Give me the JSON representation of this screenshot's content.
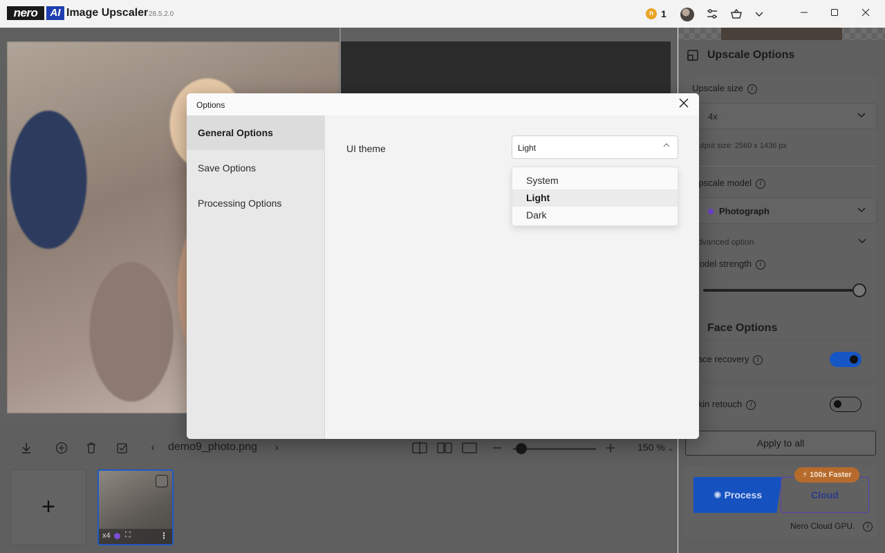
{
  "app": {
    "logo_nero": "nero",
    "logo_ai": "AI",
    "title": "Image Upscaler",
    "version": "28.5.2.0",
    "credits": "1",
    "coin_letter": "n"
  },
  "toolbar": {
    "filename": "demo9_photo.png",
    "zoom": "150 %",
    "prev": "‹",
    "next": "›"
  },
  "thumbnail": {
    "scale": "x4"
  },
  "panel": {
    "upscale_options_title": "Upscale Options",
    "upscale_size_label": "Upscale size",
    "upscale_size_value": "4x",
    "output_size": "Output size: 2560 x 1436 px",
    "upscale_model_label": "Upscale model",
    "upscale_model_value": "Photograph",
    "advanced_option_label": "Advanced option",
    "model_strength_label": "Model strength",
    "model_strength_level": 1.0,
    "face_options_title": "Face Options",
    "face_recovery_label": "Face recovery",
    "face_recovery_on": true,
    "skin_retouch_label": "Skin retouch",
    "skin_retouch_on": false,
    "apply_to_all": "Apply to all",
    "process_label": "Process",
    "cloud_label": "Cloud",
    "faster_badge": "100x Faster",
    "cloud_note": "Nero Cloud GPU."
  },
  "modal": {
    "title": "Options",
    "nav": [
      {
        "label": "General Options",
        "active": true
      },
      {
        "label": "Save Options",
        "active": false
      },
      {
        "label": "Processing Options",
        "active": false
      }
    ],
    "ui_theme_label": "UI theme",
    "ui_theme_value": "Light",
    "theme_options": [
      "System",
      "Light",
      "Dark"
    ],
    "theme_selected": "Light"
  },
  "colors": {
    "accent_blue": "#1556c4",
    "model_purple": "#6a3fd0",
    "badge_orange": "#b66b2c"
  }
}
